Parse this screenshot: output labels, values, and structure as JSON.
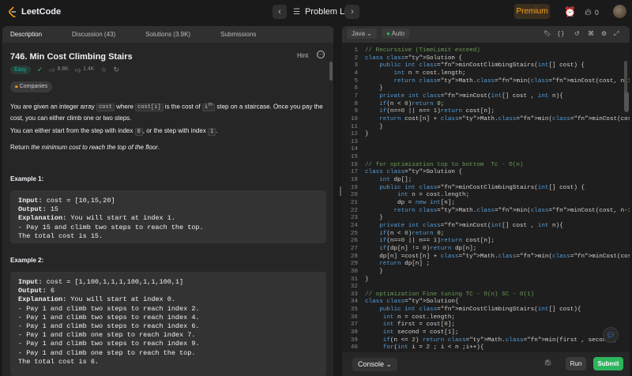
{
  "header": {
    "logo_text": "LeetCode",
    "problem_list_label": "Problem List",
    "premium_label": "Premium",
    "streak_count": "0"
  },
  "left_tabs": [
    {
      "label": "Description"
    },
    {
      "label": "Discussion (43)"
    },
    {
      "label": "Solutions (3.9K)"
    },
    {
      "label": "Submissions"
    }
  ],
  "problem": {
    "title": "746. Min Cost Climbing Stairs",
    "hint_label": "Hint",
    "difficulty": "Easy",
    "likes": "8.8K",
    "dislikes": "1.4K",
    "companies_label": "Companies",
    "p1_a": "You are given an integer array ",
    "p1_code1": "cost",
    "p1_b": " where ",
    "p1_code2": "cost[i]",
    "p1_c": " is the cost of ",
    "p1_sup": "i",
    "p1_sup2": "th",
    "p1_d": " step on a staircase. Once you pay the cost, you can either climb one or two steps.",
    "p2_a": "You can either start from the step with index ",
    "p2_code1": "0",
    "p2_b": ", or the step with index ",
    "p2_code2": "1",
    "p2_c": ".",
    "p3_a": "Return ",
    "p3_em": "the minimum cost to reach the top of the floor",
    "p3_b": "."
  },
  "examples": [
    {
      "title": "Example 1:",
      "input_label": "Input:",
      "input_value": " cost = [10,15,20]",
      "output_label": "Output:",
      "output_value": " 15",
      "explanation_label": "Explanation:",
      "explanation_lines": [
        " You will start at index 1.",
        "- Pay 15 and climb two steps to reach the top.",
        "The total cost is 15."
      ]
    },
    {
      "title": "Example 2:",
      "input_label": "Input:",
      "input_value": " cost = [1,100,1,1,1,100,1,1,100,1]",
      "output_label": "Output:",
      "output_value": " 6",
      "explanation_label": "Explanation:",
      "explanation_lines": [
        " You will start at index 0.",
        "- Pay 1 and climb two steps to reach index 2.",
        "- Pay 1 and climb two steps to reach index 4.",
        "- Pay 1 and climb two steps to reach index 6.",
        "- Pay 1 and climb one step to reach index 7.",
        "- Pay 1 and climb two steps to reach index 9.",
        "- Pay 1 and climb one step to reach the top.",
        "The total cost is 6."
      ]
    }
  ],
  "editor": {
    "language": "Java",
    "mode": "Auto",
    "console_label": "Console",
    "run_label": "Run",
    "submit_label": "Submit",
    "lines": [
      "// Recurssive (TimeLimit exceed)",
      "class Solution {",
      "    public int minCostClimbingStairs(int[] cost) {",
      "        int n = cost.length;",
      "        return Math.min(minCost(cost, n-1), minCost(cost, n-2));",
      "    }",
      "    private int minCost(int[] cost , int n){",
      "    if(n < 0)return 0;",
      "    if(n==0 || n== 1)return cost[n];",
      "    return cost[n] + Math.min(minCost(cost, n-1), minCost(cost, n-2));",
      "    }",
      "}",
      "",
      "",
      "",
      "// for optimization top to bottom  Tc - O(n)",
      "class Solution {",
      "    int dp[];",
      "    public int minCostClimbingStairs(int[] cost) {",
      "         int n = cost.length;",
      "         dp = new int[n];",
      "        return Math.min(minCost(cost, n-1), minCost(cost, n-2));",
      "    }",
      "    private int minCost(int[] cost , int n){",
      "    if(n < 0)return 0;",
      "    if(n==0 || n== 1)return cost[n];",
      "    if(dp[n] != 0)return dp[n];",
      "    dp[n] =cost[n] + Math.min(minCost(cost, n-1), minCost(cost, n-2));",
      "    return dp[n] ;",
      "    }",
      "}",
      "",
      "// optimization Fine tuning TC - O(n) SC - O(1)",
      "class Solution{",
      "    public int minCostClimbingStairs(int[] cost){",
      "     int n = cost.length;",
      "     int first = cost[0];",
      "     int second = cost[1];",
      "     if(n <= 2) return Math.min(first , second);",
      "     for(int i = 2 ; i < n ;i++){"
    ]
  }
}
